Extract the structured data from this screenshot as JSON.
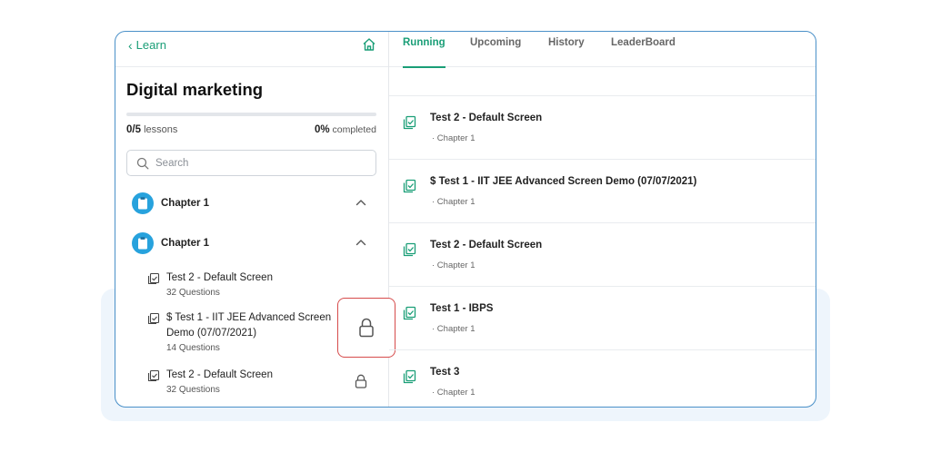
{
  "colors": {
    "accent": "#1a9e77",
    "chapter_avatar": "#27a2dd",
    "highlight": "#d64b4b",
    "frame": "#4a90c8"
  },
  "header": {
    "back_label": "Learn",
    "back_icon": "chevron-left-icon",
    "home_icon": "home-icon"
  },
  "course": {
    "title": "Digital marketing",
    "lessons_count": "0/5",
    "lessons_label": "lessons",
    "completed_percent": "0%",
    "completed_label": "completed",
    "progress_fraction": 0
  },
  "search": {
    "placeholder": "Search",
    "value": ""
  },
  "chapters": [
    {
      "label": "Chapter 1",
      "expanded": false
    },
    {
      "label": "Chapter 1",
      "expanded": true
    }
  ],
  "tests": [
    {
      "title": "Test 2 - Default Screen",
      "subtitle": "32 Questions",
      "locked": false
    },
    {
      "title": "$ Test 1 - IIT JEE Advanced Screen Demo (07/07/2021)",
      "subtitle": "14 Questions",
      "locked": true
    },
    {
      "title": "Test 2 - Default Screen",
      "subtitle": "32 Questions",
      "locked": true
    }
  ],
  "tabs": [
    {
      "label": "Running",
      "active": true
    },
    {
      "label": "Upcoming",
      "active": false
    },
    {
      "label": "History",
      "active": false
    },
    {
      "label": "LeaderBoard",
      "active": false
    }
  ],
  "right_list": [
    {
      "title": "Test 2 - Default Screen",
      "subtitle": "· Chapter 1"
    },
    {
      "title": "$ Test 1 - IIT JEE Advanced Screen Demo (07/07/2021)",
      "subtitle": "· Chapter 1"
    },
    {
      "title": "Test 2 - Default Screen",
      "subtitle": "· Chapter 1"
    },
    {
      "title": "Test 1 - IBPS",
      "subtitle": "· Chapter 1"
    },
    {
      "title": "Test 3",
      "subtitle": "· Chapter 1"
    }
  ]
}
